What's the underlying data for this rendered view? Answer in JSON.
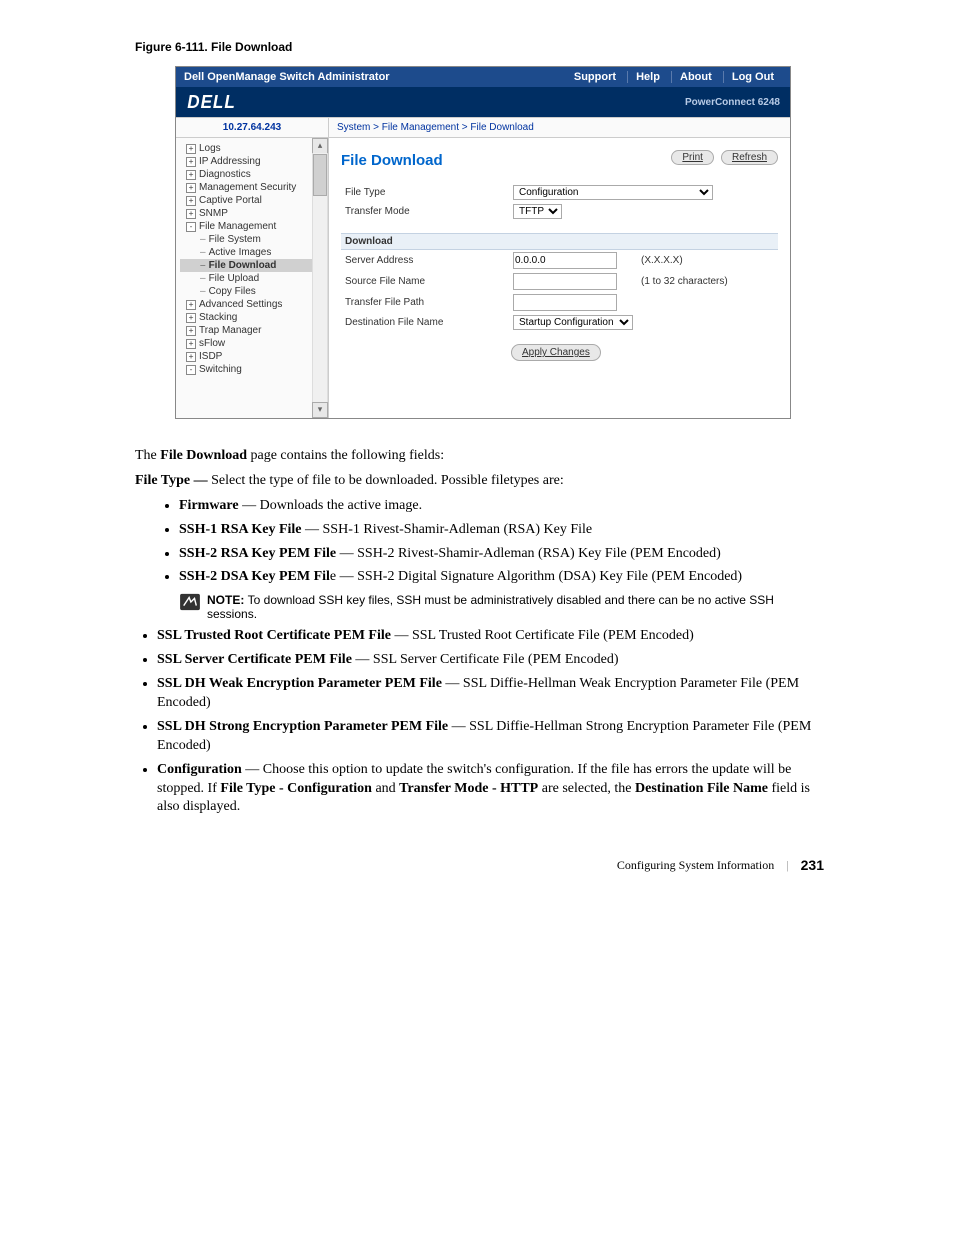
{
  "figure_caption": "Figure 6-111.   File Download",
  "topbar": {
    "title": "Dell OpenManage Switch Administrator",
    "nav": [
      "Support",
      "Help",
      "About",
      "Log Out"
    ]
  },
  "logo": "DELL",
  "product": "PowerConnect 6248",
  "ip": "10.27.64.243",
  "breadcrumb": "System > File Management > File Download",
  "sidebar": [
    {
      "lvl": 1,
      "box": "+",
      "label": "Logs"
    },
    {
      "lvl": 1,
      "box": "+",
      "label": "IP Addressing"
    },
    {
      "lvl": 1,
      "box": "+",
      "label": "Diagnostics"
    },
    {
      "lvl": 1,
      "box": "+",
      "label": "Management Security"
    },
    {
      "lvl": 1,
      "box": "+",
      "label": "Captive Portal"
    },
    {
      "lvl": 1,
      "box": "+",
      "label": "SNMP"
    },
    {
      "lvl": 1,
      "box": "-",
      "label": "File Management"
    },
    {
      "lvl": 2,
      "box": "",
      "label": "File System",
      "dash": true
    },
    {
      "lvl": 2,
      "box": "",
      "label": "Active Images",
      "dash": true
    },
    {
      "lvl": 2,
      "box": "",
      "label": "File Download",
      "dash": true,
      "selected": true
    },
    {
      "lvl": 2,
      "box": "",
      "label": "File Upload",
      "dash": true
    },
    {
      "lvl": 2,
      "box": "",
      "label": "Copy Files",
      "dash": true
    },
    {
      "lvl": 1,
      "box": "+",
      "label": "Advanced Settings"
    },
    {
      "lvl": 1,
      "box": "+",
      "label": "Stacking"
    },
    {
      "lvl": 1,
      "box": "+",
      "label": "Trap Manager"
    },
    {
      "lvl": 1,
      "box": "+",
      "label": "sFlow"
    },
    {
      "lvl": 1,
      "box": "+",
      "label": "ISDP"
    },
    {
      "lvl": 0,
      "box": "-",
      "label": "Switching"
    }
  ],
  "page_title": "File Download",
  "buttons": {
    "print": "Print",
    "refresh": "Refresh",
    "apply": "Apply Changes"
  },
  "form": {
    "file_type_label": "File Type",
    "file_type_value": "Configuration",
    "transfer_mode_label": "Transfer Mode",
    "transfer_mode_value": "TFTP",
    "download_section": "Download",
    "server_addr_label": "Server Address",
    "server_addr_value": "0.0.0.0",
    "server_addr_hint": "(X.X.X.X)",
    "source_file_label": "Source File Name",
    "source_file_value": "",
    "source_file_hint": "(1 to 32 characters)",
    "transfer_path_label": "Transfer File Path",
    "transfer_path_value": "",
    "dest_file_label": "Destination File Name",
    "dest_file_value": "Startup Configuration"
  },
  "body": {
    "p1a": "The ",
    "p1b": "File Download",
    "p1c": " page contains the following fields:",
    "p2a": "File Type — ",
    "p2b": "Select the type of file to be downloaded. Possible filetypes are:",
    "li1a": "Firmware",
    "li1b": " — Downloads the active image.",
    "li2a": "SSH-1 RSA Key File",
    "li2b": " — SSH-1 Rivest-Shamir-Adleman (RSA) Key File",
    "li3a": "SSH-2 RSA Key PEM File",
    "li3b": " — SSH-2 Rivest-Shamir-Adleman (RSA) Key File (PEM Encoded)",
    "li4a": "SSH-2 DSA Key PEM Fil",
    "li4b": "e — SSH-2 Digital Signature Algorithm (DSA) Key File (PEM Encoded)",
    "note_label": "NOTE: ",
    "note_text": "To download SSH key files, SSH must be administratively disabled and there can be no active SSH sessions.",
    "li5a": "SSL Trusted Root Certificate PEM File",
    "li5b": " — SSL Trusted Root Certificate File (PEM Encoded)",
    "li6a": "SSL Server Certificate PEM File",
    "li6b": " — SSL Server Certificate File (PEM Encoded)",
    "li7a": "SSL DH Weak Encryption Parameter PEM File",
    "li7b": " — SSL Diffie-Hellman Weak Encryption Parameter File (PEM Encoded)",
    "li8a": "SSL DH Strong Encryption Parameter PEM File",
    "li8b": " — SSL Diffie-Hellman Strong Encryption Parameter File (PEM Encoded)",
    "li9a": "Configuration",
    "li9b": " — Choose this option to update the switch's configuration. If the file has errors the update will be stopped. If ",
    "li9c": "File Type - Configuration",
    "li9d": " and ",
    "li9e": "Transfer Mode - HTTP",
    "li9f": " are selected, the ",
    "li9g": "Destination File Name",
    "li9h": " field is also displayed."
  },
  "footer": {
    "section": "Configuring System Information",
    "page": "231"
  }
}
